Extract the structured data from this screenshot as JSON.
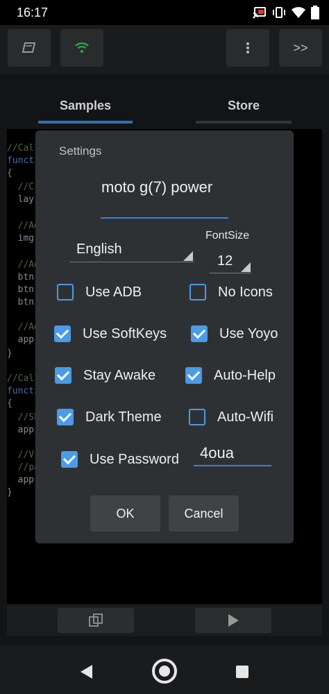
{
  "status_bar": {
    "time": "16:17",
    "icons": [
      "cast-icon",
      "vibrate-icon",
      "wifi-icon",
      "battery-icon"
    ]
  },
  "toolbar": {
    "buttons": [
      "book-icon",
      "wifi-icon",
      "more-vert-icon"
    ],
    "forward_label": ">>"
  },
  "tabs": [
    {
      "label": "Samples",
      "active": true
    },
    {
      "label": "Store",
      "active": false
    }
  ],
  "editor": {
    "lines": [
      "//Call",
      "functi",
      "{",
      "  //Cre",
      "  lay =",
      "",
      "  //Ad",
      "  img =",
      "",
      "  //Ad",
      "  btn =",
      "  btn.S",
      "  btn.S",
      "",
      "  //Ad",
      "  app.A",
      "}",
      "",
      "//Call",
      "functi",
      "{",
      "  //Sho",
      "  app.S",
      "",
      "  //Vib",
      "  //pau",
      "  app.V",
      "}"
    ]
  },
  "dialog": {
    "title": "Settings",
    "device_name": "moto g(7) power",
    "language": "English",
    "font_size_label": "FontSize",
    "font_size": "12",
    "options": [
      {
        "label": "Use ADB",
        "checked": false
      },
      {
        "label": "No Icons",
        "checked": false
      },
      {
        "label": "Use SoftKeys",
        "checked": true
      },
      {
        "label": "Use Yoyo",
        "checked": true
      },
      {
        "label": "Stay Awake",
        "checked": true
      },
      {
        "label": "Auto-Help",
        "checked": true
      },
      {
        "label": "Dark Theme",
        "checked": true
      },
      {
        "label": "Auto-Wifi",
        "checked": false
      },
      {
        "label": "Use Password",
        "checked": true
      }
    ],
    "password": "4oua",
    "ok_label": "OK",
    "cancel_label": "Cancel"
  },
  "bottom_bar": {
    "buttons": [
      "copy-icon",
      "play-icon"
    ]
  },
  "nav_bar": {
    "buttons": [
      "back-icon",
      "home-icon",
      "recents-icon"
    ]
  },
  "colors": {
    "accent": "#4a9be8",
    "dialog_bg": "#2e3134",
    "tab_underline": "#2f6fb5"
  }
}
